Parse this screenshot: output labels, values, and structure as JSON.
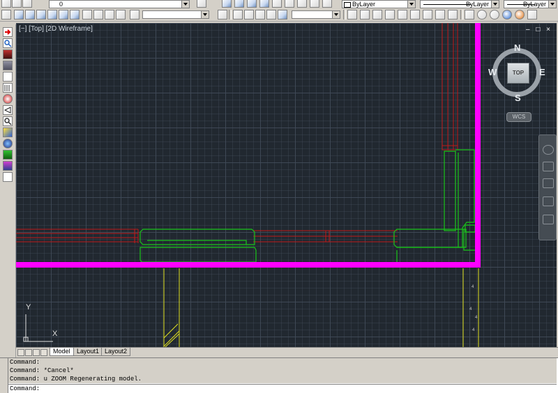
{
  "toolbar": {
    "layer_dropdown": {
      "value": "0"
    },
    "color_dropdown": {
      "value": "ByLayer"
    },
    "linetype_dropdown": {
      "value": "ByLayer"
    },
    "lineweight_dropdown": {
      "value": "ByLayer"
    }
  },
  "viewport": {
    "label": "[−] [Top] [2D Wireframe]",
    "controls": "– □ ×"
  },
  "viewcube": {
    "face": "TOP",
    "north": "N",
    "south": "S",
    "east": "E",
    "west": "W",
    "wcs": "WCS"
  },
  "ucs": {
    "x_axis": "X",
    "y_axis": "Y"
  },
  "tabs": [
    "Model",
    "Layout1",
    "Layout2"
  ],
  "active_tab": "Model",
  "command": {
    "history": [
      "Command:",
      "Command: *Cancel*",
      "Command: u ZOOM Regenerating model."
    ],
    "prompt": "Command:"
  },
  "colors": {
    "canvas": "#212830",
    "wall_outline": "#ff00ff",
    "window": "#c01818",
    "door": "#19c419",
    "hatch": "#e0e020"
  }
}
